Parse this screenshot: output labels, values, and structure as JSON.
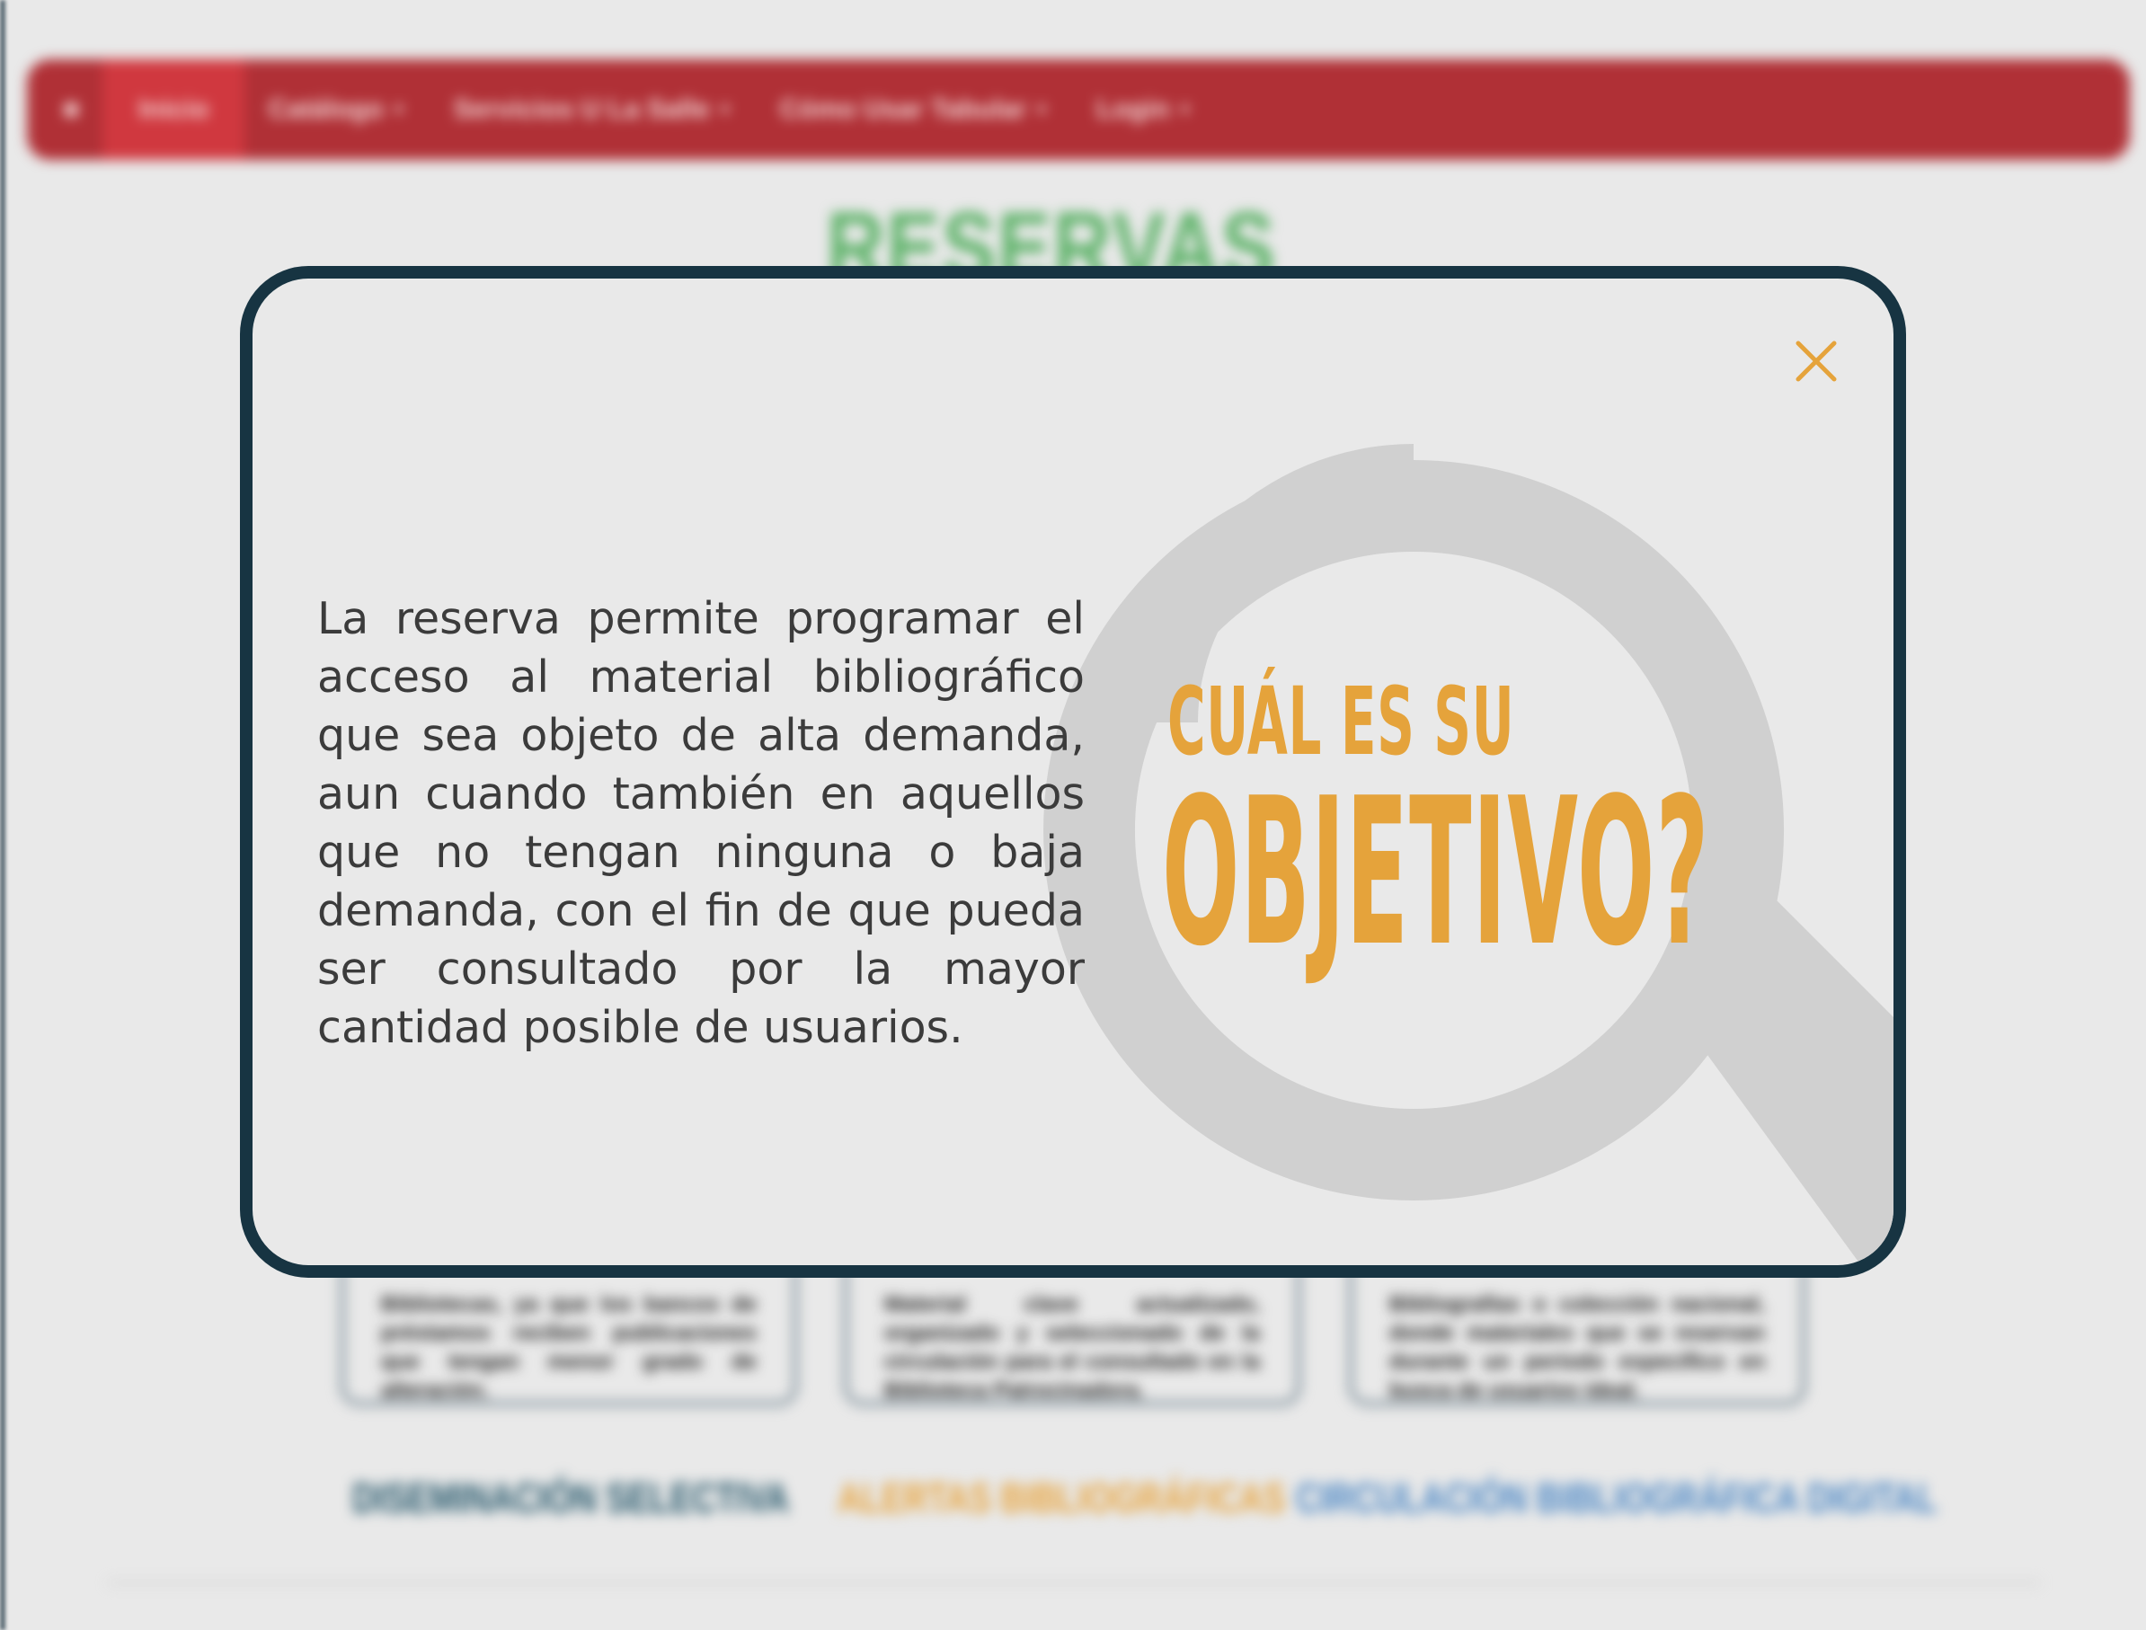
{
  "background": {
    "navbar": {
      "home_icon": "home-icon",
      "items": [
        {
          "label": "Inicio",
          "has_caret": false
        },
        {
          "label": "Catálogo",
          "has_caret": true
        },
        {
          "label": "Servicios U La Salle",
          "has_caret": true
        },
        {
          "label": "Cómo Usar Tabular",
          "has_caret": true
        },
        {
          "label": "Login",
          "has_caret": true
        }
      ]
    },
    "title": "RESERVAS WEB",
    "cards": [
      {
        "text": "Bibliotecas, ya que los bancos de préstamos reciben publicaciones que tengan menor grado de alteración."
      },
      {
        "text": "Material clave actualizado, organizado y seleccionado de la circulación para el consultado en la Biblioteca Patrocinadora."
      },
      {
        "text": "Bibliografías o colección nacional, donde materiales que se reservan durante un periodo específico en busca de usuarios ideal."
      }
    ],
    "links": [
      {
        "label": "DISEMINACIÓN SELECTIVA"
      },
      {
        "label": "ALERTAS BIBLIOGRÁFICAS"
      },
      {
        "label": "CIRCULACIÓN BIBLIOGRÁFICA DIGITAL"
      }
    ]
  },
  "modal": {
    "body_text": "La reserva permite programar el acceso al material bibliográfico que sea objeto de alta demanda, aun cuando también en aquellos que no tengan ninguna o baja demanda, con el fin de que pueda ser consultado por la mayor cantidad posible de usuarios.",
    "headline_line1": "CUÁL ES SU",
    "headline_line2": "OBJETIVO?",
    "close_icon": "close-icon",
    "decoration_icon": "magnifying-glass-icon"
  },
  "colors": {
    "navbar": "#b03036",
    "navbar_active": "#d0383f",
    "modal_border": "#173442",
    "accent_orange": "#e5a33b",
    "text_dark": "#3b3b3b",
    "magnifier_gray": "#d0d0d0",
    "title_green": "#5fb36a"
  }
}
